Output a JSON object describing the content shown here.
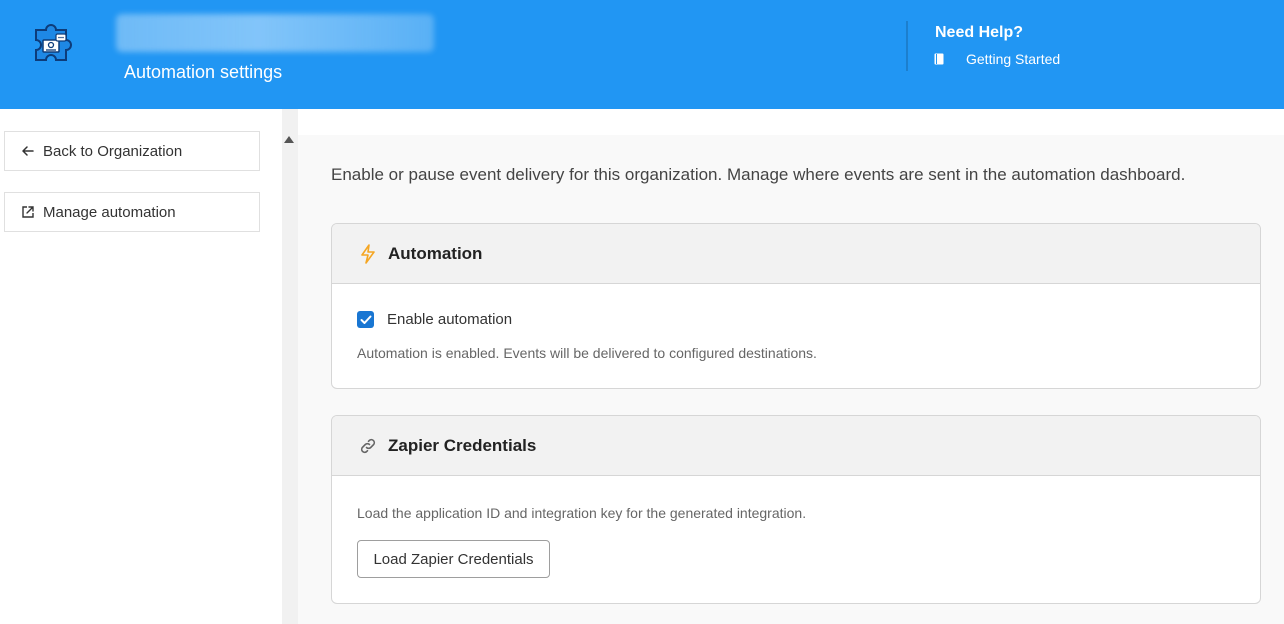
{
  "header": {
    "page_title": "Automation settings",
    "help_title": "Need Help?",
    "help_link": "Getting Started",
    "icons": {
      "logo": "puzzle-logo-icon",
      "help": "book-icon"
    },
    "colors": {
      "primary": "#2196f3",
      "text": "#ffffff"
    }
  },
  "sidebar": {
    "back_label": "Back to Organization",
    "manage_label": "Manage automation",
    "icons": {
      "back": "arrow-left-icon",
      "manage": "external-link-icon"
    }
  },
  "main": {
    "intro": "Enable or pause event delivery for this organization. Manage where events are sent in the automation dashboard.",
    "automation_card": {
      "title": "Automation",
      "icon": "lightning-bolt-icon",
      "icon_color": "#f5a623",
      "checkbox_label": "Enable automation",
      "checkbox_checked": true,
      "checkbox_color": "#1976d2",
      "status_note": "Automation is enabled. Events will be delivered to configured destinations."
    },
    "zapier_card": {
      "title": "Zapier Credentials",
      "icon": "link-icon",
      "note": "Load the application ID and integration key for the generated integration.",
      "button_label": "Load Zapier Credentials"
    }
  }
}
